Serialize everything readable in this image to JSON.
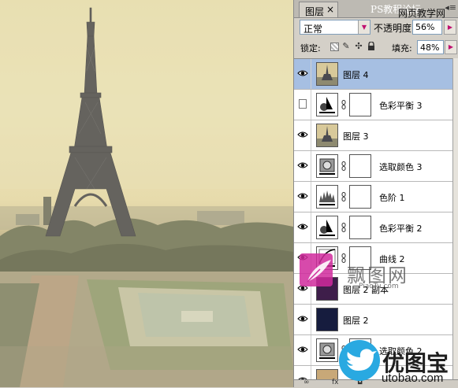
{
  "panel": {
    "tab_label": "图层",
    "tab_close": "×",
    "tab_menu": "◂≡",
    "blend_mode": "正常",
    "opacity_label": "不透明度:",
    "opacity_value": "56%",
    "lock_label": "锁定:",
    "fill_label": "填充:",
    "fill_value": "48%"
  },
  "layers": [
    {
      "name": "图层 4",
      "visible": true,
      "selected": true,
      "thumb": "photo",
      "mask": false
    },
    {
      "name": "色彩平衡 3",
      "visible": false,
      "selected": false,
      "thumb": "balance-icon",
      "mask": true
    },
    {
      "name": "图层 3",
      "visible": true,
      "selected": false,
      "thumb": "photo",
      "mask": false
    },
    {
      "name": "选取颜色 3",
      "visible": true,
      "selected": false,
      "thumb": "selective-icon",
      "mask": true
    },
    {
      "name": "色阶 1",
      "visible": true,
      "selected": false,
      "thumb": "levels-icon",
      "mask": true
    },
    {
      "name": "色彩平衡 2",
      "visible": true,
      "selected": false,
      "thumb": "balance-icon",
      "mask": true
    },
    {
      "name": "曲线 2",
      "visible": true,
      "selected": false,
      "thumb": "curves-icon",
      "mask": true
    },
    {
      "name": "图层 2 副本",
      "visible": true,
      "selected": false,
      "thumb": "dark-purple",
      "mask": false
    },
    {
      "name": "图层 2",
      "visible": true,
      "selected": false,
      "thumb": "dark-navy",
      "mask": false
    },
    {
      "name": "选取颜色 2",
      "visible": true,
      "selected": false,
      "thumb": "selective-icon",
      "mask": true
    },
    {
      "name": "",
      "visible": true,
      "selected": false,
      "thumb": "tan",
      "mask": false
    }
  ],
  "watermarks": {
    "top_white": "PS教程论坛",
    "top_black": "网页教学网",
    "mid_cn": "飘图网",
    "mid_en": "PiaoTu.com",
    "bottom_cn": "优图宝",
    "bottom_en": "utobao.com"
  },
  "colors": {
    "selected_row": "#a6bfe2",
    "accent_pink": "#c01070",
    "logo_blue": "#29a9e1",
    "logo_pink": "#d02a9c"
  },
  "icons": {
    "eye": "eye-icon",
    "chain": "chain-link-icon",
    "lock_pixels": "lock-transparent-icon",
    "lock_paint": "brush-icon",
    "lock_move": "move-icon",
    "lock_all": "lock-icon"
  }
}
